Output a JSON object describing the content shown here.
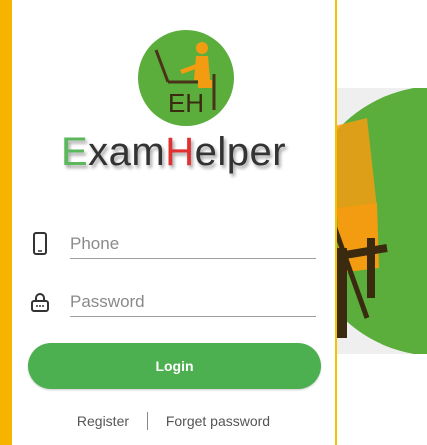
{
  "app": {
    "brand_first_letter": "E",
    "brand_part1": "xam",
    "brand_second_letter": "H",
    "brand_part2": "elper",
    "logo_text": "EH"
  },
  "form": {
    "phone_placeholder": "Phone",
    "password_placeholder": "Password",
    "login_label": "Login"
  },
  "links": {
    "register_label": "Register",
    "separator": "|",
    "forget_label": "Forget password"
  },
  "colors": {
    "accent_yellow": "#f6b400",
    "brand_green": "#5cb85c",
    "brand_red": "#e03030",
    "button_green": "#4caf50",
    "logo_orange": "#f39c12"
  },
  "icons": {
    "phone": "phone-icon",
    "password": "lock-icon"
  }
}
